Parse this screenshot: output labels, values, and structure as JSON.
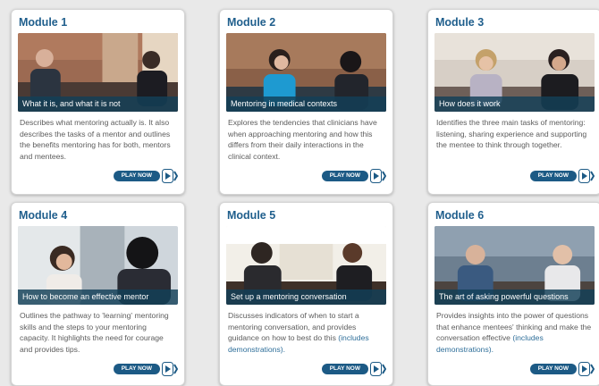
{
  "modules": [
    {
      "title": "Module 1",
      "caption": "What it is, and what it is not",
      "description": "Describes what mentoring actually is. It also describes the tasks of a mentor and outlines the benefits mentoring has for both, mentors and mentees.",
      "extra": "",
      "button": "PLAY NOW"
    },
    {
      "title": "Module 2",
      "caption": "Mentoring in medical contexts",
      "description": "Explores the tendencies that clinicians have when approaching mentoring and how this differs from their daily interactions in the clinical context.",
      "extra": "",
      "button": "PLAY NOW"
    },
    {
      "title": "Module 3",
      "caption": "How does it work",
      "description": "Identifies the three main tasks of mentoring: listening, sharing experience and supporting the mentee to think through together.",
      "extra": "",
      "button": "PLAY NOW"
    },
    {
      "title": "Module 4",
      "caption": "How to become an effective mentor",
      "description": "Outlines the pathway to 'learning' mentoring skills and the steps to your mentoring capacity. It highlights the need for courage and provides tips.",
      "extra": "",
      "button": "PLAY NOW"
    },
    {
      "title": "Module 5",
      "caption": "Set up a mentoring conversation",
      "description": "Discusses indicators of when to start a mentoring conversation, and provides guidance on how to best do this ",
      "extra": "(includes demonstrations).",
      "button": "PLAY NOW"
    },
    {
      "title": "Module 6",
      "caption": "The art of asking powerful questions",
      "description": "Provides insights into the power of questions that enhance mentees' thinking and make the conversation effective ",
      "extra": "(includes demonstrations).",
      "button": "PLAY NOW"
    }
  ]
}
